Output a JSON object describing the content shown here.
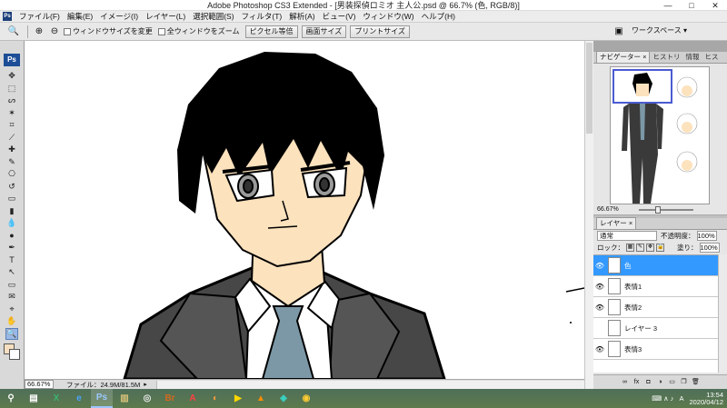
{
  "window": {
    "title": "Adobe Photoshop CS3 Extended - [男装探偵ロミオ 主人公.psd @ 66.7% (色, RGB/8)]",
    "minimize": "—",
    "maximize": "□",
    "close": "✕"
  },
  "menu": {
    "items": [
      "ファイル(F)",
      "編集(E)",
      "イメージ(I)",
      "レイヤー(L)",
      "選択範囲(S)",
      "フィルタ(T)",
      "解析(A)",
      "ビュー(V)",
      "ウィンドウ(W)",
      "ヘルプ(H)"
    ]
  },
  "options": {
    "resize_windows": "ウィンドウサイズを変更",
    "zoom_all": "全ウィンドウをズーム",
    "actual_pixels": "ピクセル等倍",
    "fit_screen": "画面サイズ",
    "print_size": "プリントサイズ",
    "workspace": "ワークスペース ▾"
  },
  "toolbox": {
    "logo": "Ps",
    "tools": [
      "move-icon",
      "marquee-icon",
      "lasso-icon",
      "magic-wand-icon",
      "crop-icon",
      "slice-icon",
      "healing-icon",
      "brush-icon",
      "stamp-icon",
      "history-brush-icon",
      "eraser-icon",
      "gradient-icon",
      "blur-icon",
      "dodge-icon",
      "pen-icon",
      "type-icon",
      "path-select-icon",
      "shape-icon",
      "notes-icon",
      "eyedropper-icon",
      "hand-icon",
      "zoom-icon"
    ],
    "tool_glyphs": [
      "✥",
      "⬚",
      "ᔕ",
      "✶",
      "⌗",
      "⟋",
      "✚",
      "✎",
      "⎔",
      "↺",
      "▭",
      "▮",
      "💧",
      "●",
      "✒",
      "T",
      "↖",
      "▭",
      "✉",
      "⌖",
      "✋",
      "🔍"
    ],
    "active_tool_index": 21
  },
  "status": {
    "zoom": "66.67%",
    "file": "ファイル：24.9M/81.5M",
    "arrow": "▸"
  },
  "navigator": {
    "tabs": [
      "ナビゲーター",
      "ヒストリ",
      "情報",
      "ヒス"
    ],
    "tab_suffix": "×",
    "zoom": "66.67%"
  },
  "layers": {
    "tab": "レイヤー ×",
    "blend_mode": "通常",
    "opacity_label": "不透明度：",
    "opacity_value": "100%",
    "lock_label": "ロック：",
    "fill_label": "塗り：",
    "fill_value": "100%",
    "items": [
      {
        "name": "色",
        "visible": "true",
        "selected": "true"
      },
      {
        "name": "表情1",
        "visible": "true",
        "selected": "false"
      },
      {
        "name": "表情2",
        "visible": "true",
        "selected": "false"
      },
      {
        "name": "レイヤー 3",
        "visible": "false",
        "selected": "false"
      },
      {
        "name": "表情3",
        "visible": "true",
        "selected": "false"
      }
    ]
  },
  "taskbar": {
    "apps": [
      "search-icon",
      "task-view-icon",
      "excel-icon",
      "edge-icon",
      "photoshop-icon",
      "explorer-icon",
      "app-icon",
      "bridge-icon",
      "acrobat-icon",
      "illustrator-icon",
      "media-player-icon",
      "vlc-icon",
      "edge-new-icon",
      "chrome-icon"
    ],
    "app_glyphs": [
      "⚲",
      "▤",
      "X",
      "e",
      "Ps",
      "▥",
      "◎",
      "Br",
      "A",
      "◐",
      "▶",
      "▲",
      "◈",
      "◉"
    ],
    "active_index": 4,
    "tray_ime": "A",
    "tray_icons": "⌨ ∧ ♪",
    "time": "13:54",
    "date": "2020/04/12"
  }
}
